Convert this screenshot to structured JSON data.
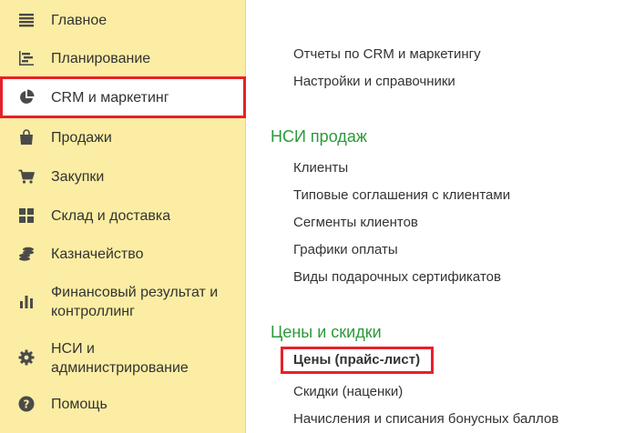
{
  "sidebar": {
    "items": [
      {
        "label": "Главное"
      },
      {
        "label": "Планирование"
      },
      {
        "label": "CRM и маркетинг"
      },
      {
        "label": "Продажи"
      },
      {
        "label": "Закупки"
      },
      {
        "label": "Склад и доставка"
      },
      {
        "label": "Казначейство"
      },
      {
        "label": "Финансовый результат и контроллинг"
      },
      {
        "label": "НСИ и администрирование"
      },
      {
        "label": "Помощь"
      }
    ]
  },
  "content": {
    "top_links": [
      "Отчеты по CRM и маркетингу",
      "Настройки и справочники"
    ],
    "sections": [
      {
        "title": "НСИ продаж",
        "links": [
          "Клиенты",
          "Типовые соглашения с клиентами",
          "Сегменты клиентов",
          "Графики оплаты",
          "Виды подарочных сертификатов"
        ]
      },
      {
        "title": "Цены и скидки",
        "links": [
          "Цены (прайс-лист)",
          "Скидки (наценки)",
          "Начисления и списания бонусных баллов"
        ]
      }
    ]
  },
  "colors": {
    "sidebar_bg": "#fbeda3",
    "section_title": "#2a9a3a",
    "highlight_border": "#e8202a",
    "icon": "#4a4a4a"
  },
  "icons": {
    "main": "menu-lines-icon",
    "planning": "planning-chart-icon",
    "crm": "pie-chart-icon",
    "sales": "shopping-bag-icon",
    "purchases": "shopping-cart-icon",
    "warehouse": "warehouse-grid-icon",
    "treasury": "coins-stack-icon",
    "finance": "bar-chart-icon",
    "admin": "gear-icon",
    "help": "question-icon"
  }
}
